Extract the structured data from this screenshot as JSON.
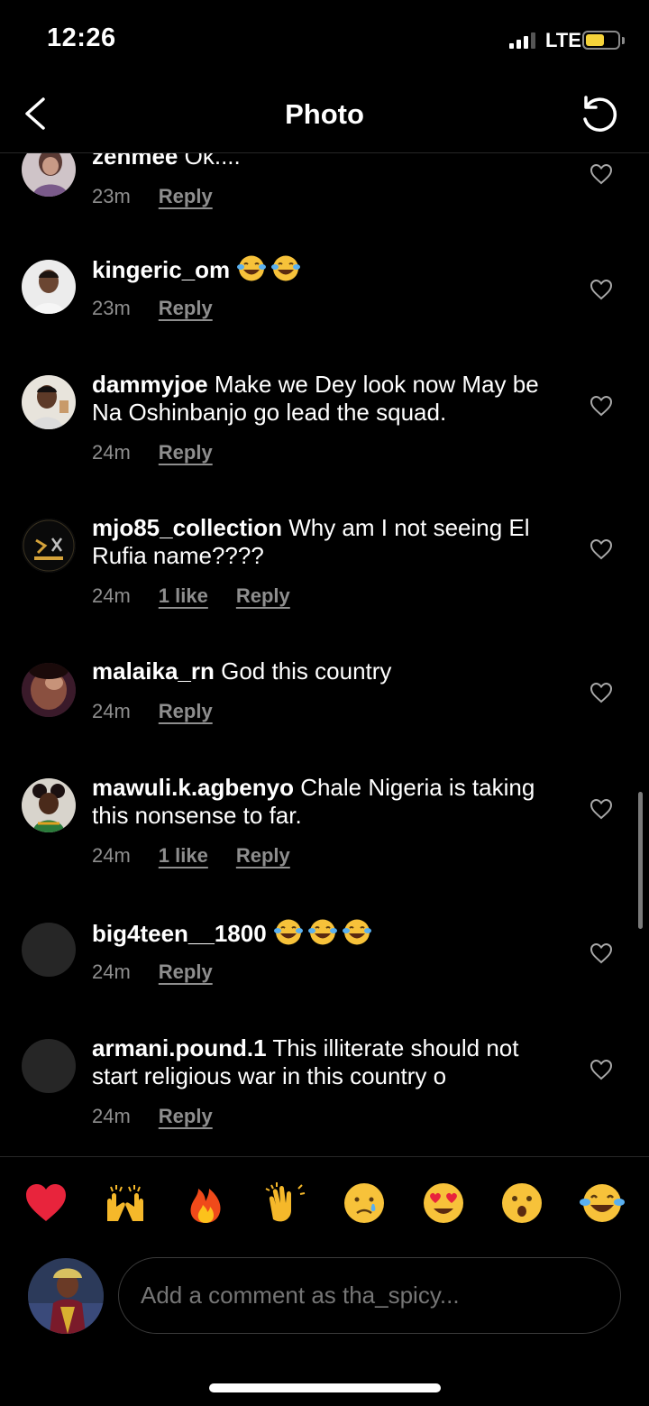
{
  "status": {
    "time": "12:26",
    "network": "LTE",
    "battery_level": 0.5
  },
  "nav": {
    "title": "Photo",
    "back_icon": "chevron-left-icon",
    "refresh_icon": "refresh-icon"
  },
  "comments": [
    {
      "username": "zenmee",
      "text": "Ok....",
      "time": "23m",
      "likes": "",
      "reply": "Reply",
      "emojis": []
    },
    {
      "username": "kingeric_om",
      "text": "",
      "time": "23m",
      "likes": "",
      "reply": "Reply",
      "emojis": [
        "face-with-tears-of-joy",
        "face-with-tears-of-joy"
      ]
    },
    {
      "username": "dammyjoe",
      "text": "Make we Dey look now May be Na Oshinbanjo go lead the squad.",
      "time": "24m",
      "likes": "",
      "reply": "Reply",
      "emojis": []
    },
    {
      "username": "mjo85_collection",
      "text": "Why am I not seeing El Rufia name????",
      "time": "24m",
      "likes": "1 like",
      "reply": "Reply",
      "emojis": []
    },
    {
      "username": "malaika_rn",
      "text": "God this country",
      "time": "24m",
      "likes": "",
      "reply": "Reply",
      "emojis": []
    },
    {
      "username": "mawuli.k.agbenyo",
      "text": "Chale Nigeria is taking this nonsense to far.",
      "time": "24m",
      "likes": "1 like",
      "reply": "Reply",
      "emojis": []
    },
    {
      "username": "big4teen__1800",
      "text": "",
      "time": "24m",
      "likes": "",
      "reply": "Reply",
      "emojis": [
        "face-with-tears-of-joy",
        "face-with-tears-of-joy",
        "face-with-tears-of-joy"
      ]
    },
    {
      "username": "armani.pound.1",
      "text": "This illiterate should not start religious war in this country o",
      "time": "24m",
      "likes": "",
      "reply": "Reply",
      "emojis": []
    }
  ],
  "reactions": [
    "heart",
    "raising-hands",
    "fire",
    "clapping-hands",
    "crying-face",
    "heart-eyes",
    "astonished-face",
    "face-with-tears-of-joy"
  ],
  "composer": {
    "placeholder": "Add a comment as tha_spicy..."
  }
}
